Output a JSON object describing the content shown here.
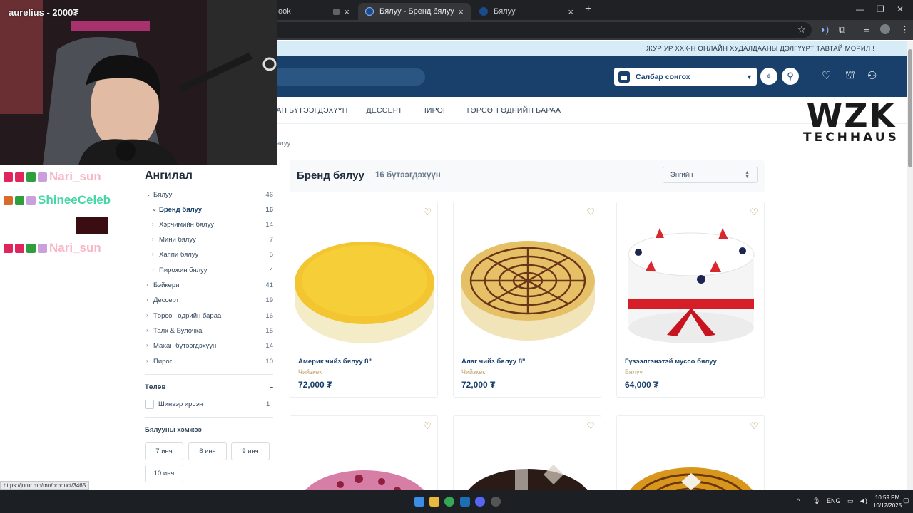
{
  "browser": {
    "tabs": [
      {
        "label": "ook"
      },
      {
        "label": "Бялуу - Бренд бялуу"
      },
      {
        "label": "Бялуу"
      }
    ],
    "new_tab": "+"
  },
  "site": {
    "announcement": "ЖУР УР ХХК-Н ОНЛАЙН ХУДАЛДААНЫ ДЭЛГҮҮРТ ТАВТАЙ МОРИЛ !",
    "branch_select": "Салбар сонгох",
    "nav": [
      "ХАН БҮТЭЭГДЭХҮҮН",
      "ДЕССЕРТ",
      "ПИРОГ",
      "ТӨРСӨН ӨДРИЙН БАРАА"
    ],
    "breadcrumb": "ялуу",
    "logo": {
      "big": "WZK",
      "small": "TECHHAUS"
    }
  },
  "sidebar": {
    "title": "Ангилал",
    "categories": [
      {
        "label": "Бялуу",
        "count": "46",
        "arrow": "⌄"
      },
      {
        "label": "Бренд бялуу",
        "count": "16",
        "arrow": "⌄"
      },
      {
        "label": "Хэрчимийн бялуу",
        "count": "14",
        "arrow": "›"
      },
      {
        "label": "Мини бялуу",
        "count": "7",
        "arrow": "›"
      },
      {
        "label": "Хаппи бялуу",
        "count": "5",
        "arrow": "›"
      },
      {
        "label": "Пирожин бялуу",
        "count": "4",
        "arrow": "›"
      },
      {
        "label": "Бэйкери",
        "count": "41",
        "arrow": "›"
      },
      {
        "label": "Дессерт",
        "count": "19",
        "arrow": "›"
      },
      {
        "label": "Төрсөн өдрийн бараа",
        "count": "16",
        "arrow": "›"
      },
      {
        "label": "Талх & Булочка",
        "count": "15",
        "arrow": "›"
      },
      {
        "label": "Махан бүтээгдэхүүн",
        "count": "14",
        "arrow": "›"
      },
      {
        "label": "Пирог",
        "count": "10",
        "arrow": "›"
      }
    ],
    "payment": {
      "title": "Төлөв",
      "toggle": "–",
      "option": "Шинээр ирсэн",
      "option_count": "1"
    },
    "size": {
      "title": "Бялууны хэмжээ",
      "toggle": "–",
      "options": [
        "7 инч",
        "8 инч",
        "9 инч",
        "10 инч"
      ]
    }
  },
  "products": {
    "title": "Бренд бялуу",
    "count_label": "16 бүтээгдэхүүн",
    "sort": "Энгийн",
    "items": [
      {
        "name": "Америк чийз бялуу 8\"",
        "sub": "Чийзкек",
        "price": "72,000 ₮"
      },
      {
        "name": "Алаг чийз бялуу 8\"",
        "sub": "Чийзкек",
        "price": "72,000 ₮"
      },
      {
        "name": "Гүзээлгэнэтэй муссо бялуу",
        "sub": "Бялуу",
        "price": "64,000 ₮"
      }
    ]
  },
  "stream": {
    "title": "aurelius - 2000₮",
    "chat": [
      {
        "user": "Nari_sun",
        "color": "#f7b8c8"
      },
      {
        "user": "ShineeCeleb",
        "color": "#43d6a6"
      },
      {
        "user": "Nari_sun",
        "color": "#f7b8c8"
      }
    ]
  },
  "status_url": "https://jurur.mn/mn/product/3465",
  "taskbar": {
    "lang": "ENG",
    "time": "10:59 PM",
    "date": "10/12/2025"
  }
}
